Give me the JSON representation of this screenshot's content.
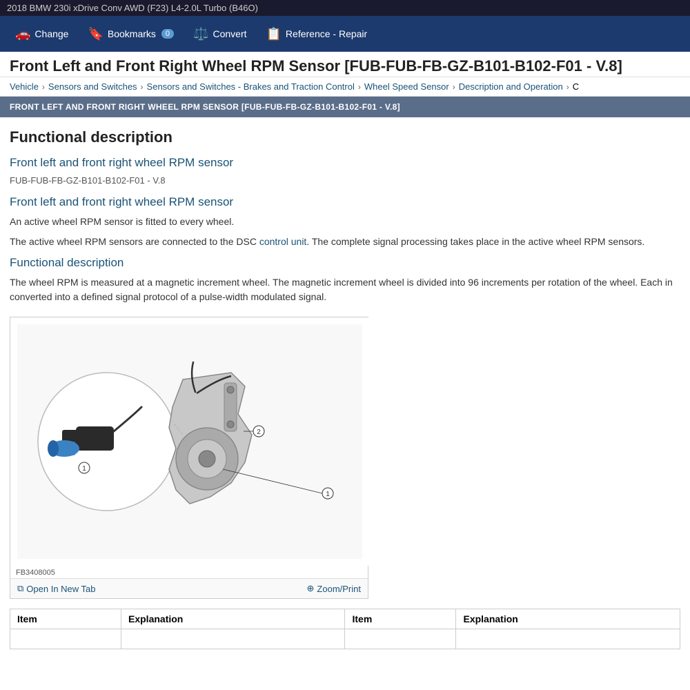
{
  "topbar": {
    "title": "2018 BMW 230i xDrive Conv AWD (F23) L4-2.0L Turbo (B46O)"
  },
  "navbar": {
    "change_label": "Change",
    "bookmarks_label": "Bookmarks",
    "bookmarks_count": "0",
    "convert_label": "Convert",
    "reference_label": "Reference - Repair"
  },
  "page_title": "Front Left and Front Right Wheel RPM Sensor [FUB-FUB-FB-GZ-B101-B102-F01 - V.8]",
  "breadcrumb": {
    "items": [
      {
        "label": "Vehicle",
        "link": true
      },
      {
        "label": "Sensors and Switches",
        "link": true
      },
      {
        "label": "Sensors and Switches - Brakes and Traction Control",
        "link": true
      },
      {
        "label": "Wheel Speed Sensor",
        "link": true
      },
      {
        "label": "Description and Operation",
        "link": true
      },
      {
        "label": "C",
        "link": false
      }
    ]
  },
  "section_header": "FRONT LEFT AND FRONT RIGHT WHEEL RPM SENSOR [FUB-FUB-FB-GZ-B101-B102-F01 - V.8]",
  "content": {
    "main_heading": "Functional description",
    "subsection1": {
      "heading": "Front left and front right wheel RPM sensor",
      "code_ref": "FUB-FUB-FB-GZ-B101-B102-F01 - V.8"
    },
    "subsection2": {
      "heading": "Front left and front right wheel RPM sensor",
      "para1": "An active wheel RPM sensor is fitted to every wheel.",
      "para2_prefix": "The active wheel RPM sensors are connected to the DSC ",
      "para2_link": "control unit",
      "para2_suffix": ". The complete signal processing takes place in the active wheel RPM sensors."
    },
    "subsection3": {
      "heading": "Functional description",
      "para1": "The wheel RPM is measured at a magnetic increment wheel. The magnetic increment wheel is divided into 96 increments per rotation of the wheel. Each in converted into a defined signal protocol of a pulse-width modulated signal."
    },
    "image": {
      "caption": "FB3408005",
      "open_tab_label": "Open In New Tab",
      "zoom_label": "Zoom/Print"
    },
    "table": {
      "headers": [
        "Item",
        "Explanation",
        "Item",
        "Explanation"
      ],
      "rows": [
        [
          "",
          "",
          "",
          ""
        ]
      ]
    }
  }
}
